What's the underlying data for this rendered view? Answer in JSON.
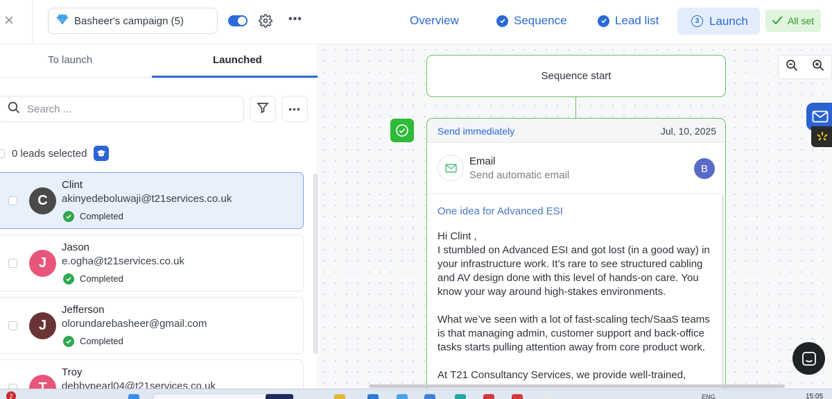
{
  "header": {
    "campaign_name": "Basheer's campaign (5)",
    "campaign_active": true,
    "nav": {
      "overview": "Overview",
      "sequence": "Sequence",
      "lead_list": "Lead list",
      "launch": "Launch",
      "launch_step": "3",
      "all_set": "All set"
    }
  },
  "leads_panel": {
    "tabs": [
      "To launch",
      "Launched"
    ],
    "active_tab": "Launched",
    "search_placeholder": "Search ...",
    "selected_text": "0 leads selected",
    "leads": [
      {
        "initial": "C",
        "name": "Clint",
        "email": "akinyedeboluwaji@t21services.co.uk",
        "status": "Completed",
        "color": "#4a4a4a",
        "selected": true
      },
      {
        "initial": "J",
        "name": "Jason",
        "email": "e.ogha@t21services.co.uk",
        "status": "Completed",
        "color": "#e8557a",
        "selected": false
      },
      {
        "initial": "J",
        "name": "Jefferson",
        "email": "olorundarebasheer@gmail.com",
        "status": "Completed",
        "color": "#6b3434",
        "selected": false
      },
      {
        "initial": "T",
        "name": "Troy",
        "email": "debbypearl04@t21services.co.uk",
        "status": "",
        "color": "#e8557a",
        "selected": false
      }
    ]
  },
  "sequence": {
    "start_label": "Sequence start",
    "step": {
      "timing": "Send immediately",
      "date": "Jul, 10, 2025",
      "type_title": "Email",
      "type_sub": "Send automatic email",
      "sender_initial": "B",
      "subject": "One idea for Advanced ESI",
      "greeting": "Hi Clint ,",
      "paragraph1": "I stumbled on Advanced ESI and got lost (in a good way) in your infrastructure work. It’s rare to see structured cabling and AV design done with this level of hands-on care. You know your way around high-stakes environments.",
      "paragraph2": "What we’ve seen with a lot of fast-scaling tech/SaaS teams is that managing admin, customer support and back-office tasks starts pulling attention away from core product work.",
      "paragraph3": "At T21 Consultancy Services, we provide well-trained,"
    }
  },
  "taskbar": {
    "notification_count": "2",
    "language": "ENG",
    "time": "15:05"
  }
}
